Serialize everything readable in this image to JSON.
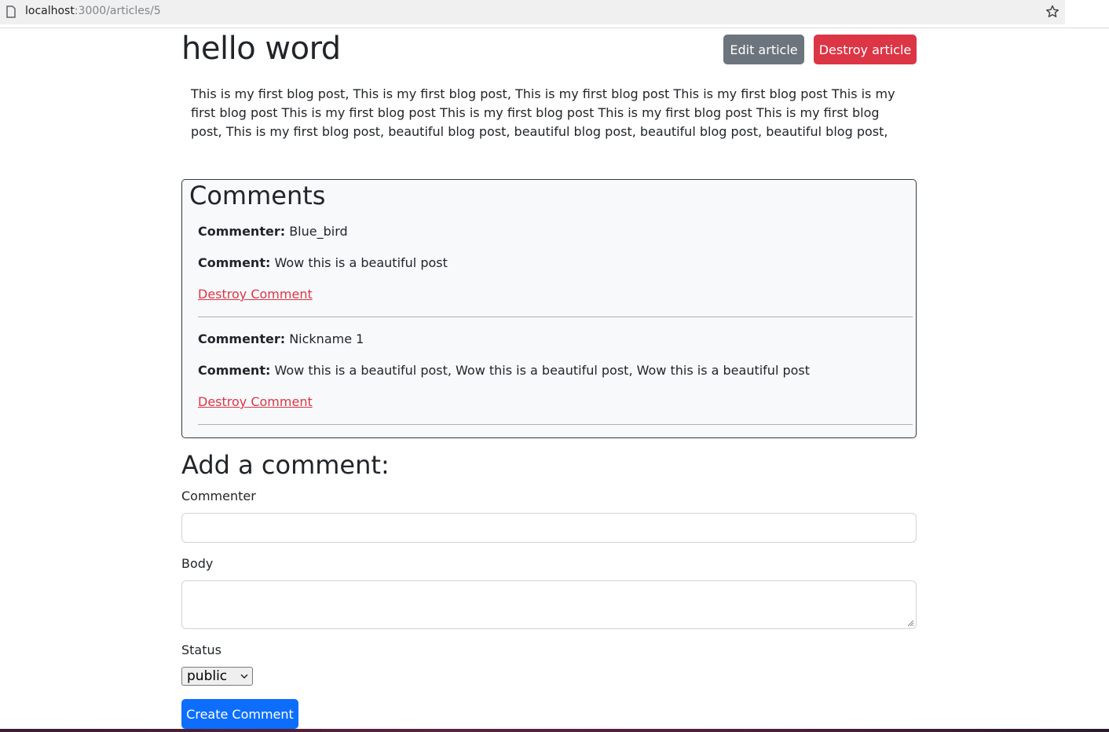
{
  "browser": {
    "url_host": "localhost",
    "url_path": ":3000/articles/5"
  },
  "article": {
    "title": "hello word",
    "edit_label": "Edit article",
    "destroy_label": "Destroy article",
    "body": "This is my first blog post, This is my first blog post, This is my first blog post This is my first blog post This is my first blog post This is my first blog post This is my first blog post This is my first blog post This is my first blog post, This is my first blog post, beautiful blog post, beautiful blog post, beautiful blog post, beautiful blog post,"
  },
  "comments": {
    "heading": "Comments",
    "commenter_label": "Commenter:",
    "comment_label": "Comment:",
    "destroy_label": "Destroy Comment",
    "items": [
      {
        "commenter": "Blue_bird",
        "body": "Wow this is a beautiful post"
      },
      {
        "commenter": "Nickname 1",
        "body": "Wow this is a beautiful post, Wow this is a beautiful post, Wow this is a beautiful post"
      }
    ]
  },
  "form": {
    "heading": "Add a comment:",
    "commenter_label": "Commenter",
    "commenter_value": "",
    "body_label": "Body",
    "body_value": "",
    "status_label": "Status",
    "status_selected": "public",
    "submit_label": "Create Comment"
  },
  "colors": {
    "secondary": "#6c757d",
    "danger": "#dc3545",
    "primary": "#0d6efd"
  }
}
